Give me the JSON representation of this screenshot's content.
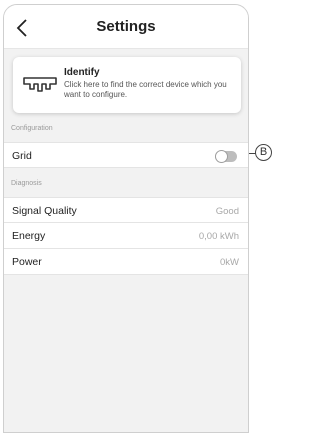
{
  "header": {
    "title": "Settings",
    "back_icon": "chevron-left-icon"
  },
  "identify": {
    "title": "Identify",
    "description": "Click here to find the correct device which you want to configure.",
    "icon": "device-icon"
  },
  "sections": {
    "configuration_label": "Configuration",
    "diagnosis_label": "Diagnosis"
  },
  "configuration": {
    "grid": {
      "label": "Grid",
      "toggle_on": false
    }
  },
  "diagnosis": {
    "signal_quality": {
      "label": "Signal Quality",
      "value": "Good"
    },
    "energy": {
      "label": "Energy",
      "value": "0,00 kWh"
    },
    "power": {
      "label": "Power",
      "value": "0kW"
    }
  },
  "callout": {
    "label": "B"
  }
}
